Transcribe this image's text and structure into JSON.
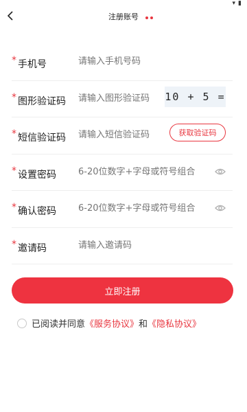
{
  "accent_color": "#e8363f",
  "header": {
    "title": "注册账号"
  },
  "status_bar": {
    "icons": [
      "wifi-icon",
      "battery-icon"
    ]
  },
  "form": {
    "required_mark": "*",
    "phone": {
      "label": "手机号",
      "placeholder": "请输入手机号码"
    },
    "captcha": {
      "label": "图形验证码",
      "placeholder": "请输入图形验证码",
      "image_text": "10 + 5 ="
    },
    "sms": {
      "label": "短信验证码",
      "placeholder": "请输入短信验证码",
      "button": "获取验证码"
    },
    "password": {
      "label": "设置密码",
      "placeholder": "6-20位数字+字母或符号组合"
    },
    "confirm": {
      "label": "确认密码",
      "placeholder": "6-20位数字+字母或符号组合"
    },
    "invite": {
      "label": "邀请码",
      "placeholder": "请输入邀请码"
    }
  },
  "register_button": "立即注册",
  "agreement": {
    "prefix": "已阅读并同意",
    "service": "《服务协议》",
    "and": "和",
    "privacy": "《隐私协议》"
  }
}
